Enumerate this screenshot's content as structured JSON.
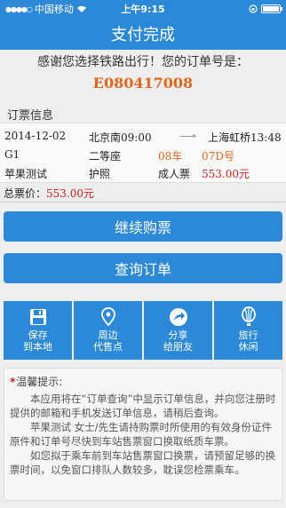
{
  "status_bar": {
    "carrier": "中国移动",
    "time": "上午9:15"
  },
  "nav": {
    "title": "支付完成"
  },
  "thanks_text": "感谢您选择铁路出行！您的订单号是：",
  "order_number": "E080417008",
  "section_title": "订票信息",
  "ticket": {
    "date": "2014-12-02",
    "from_station": "北京南09:00",
    "to_station": "上海虹桥13:48",
    "train": "G1",
    "seat_class": "二等座",
    "car": "08车",
    "seat": "07D号",
    "passenger": "苹果测试",
    "id_type": "护照",
    "ticket_type": "成人票",
    "fare": "553.00元"
  },
  "total": {
    "label": "总票价：",
    "value": "553.00元"
  },
  "buttons": {
    "continue": "继续购票",
    "query": "查询订单"
  },
  "actions": [
    {
      "line1": "保存",
      "line2": "到本地",
      "icon": "save-icon"
    },
    {
      "line1": "周边",
      "line2": "代售点",
      "icon": "location-pin-icon"
    },
    {
      "line1": "分享",
      "line2": "给朋友",
      "icon": "share-icon"
    },
    {
      "line1": "旅行",
      "line2": "休闲",
      "icon": "balloon-icon"
    }
  ],
  "tips": {
    "title": "温馨提示:",
    "p1": "本应用将在“订单查询”中显示订单信息，并向您注册时提供的邮箱和手机发送订单信息，请稍后查询。",
    "p2": "苹果测试 女士/先生请持购票时所使用的有效身份证件原件和订单号尽快到车站售票窗口换取纸质车票。",
    "p3": "如您拟于乘车前到车站售票窗口换票，请预留足够的换票时间，以免窗口排队人数较多，耽误您检票乘车。"
  },
  "colors": {
    "brand": "#2b89d7",
    "order": "#e5651a",
    "price": "#d02020"
  }
}
